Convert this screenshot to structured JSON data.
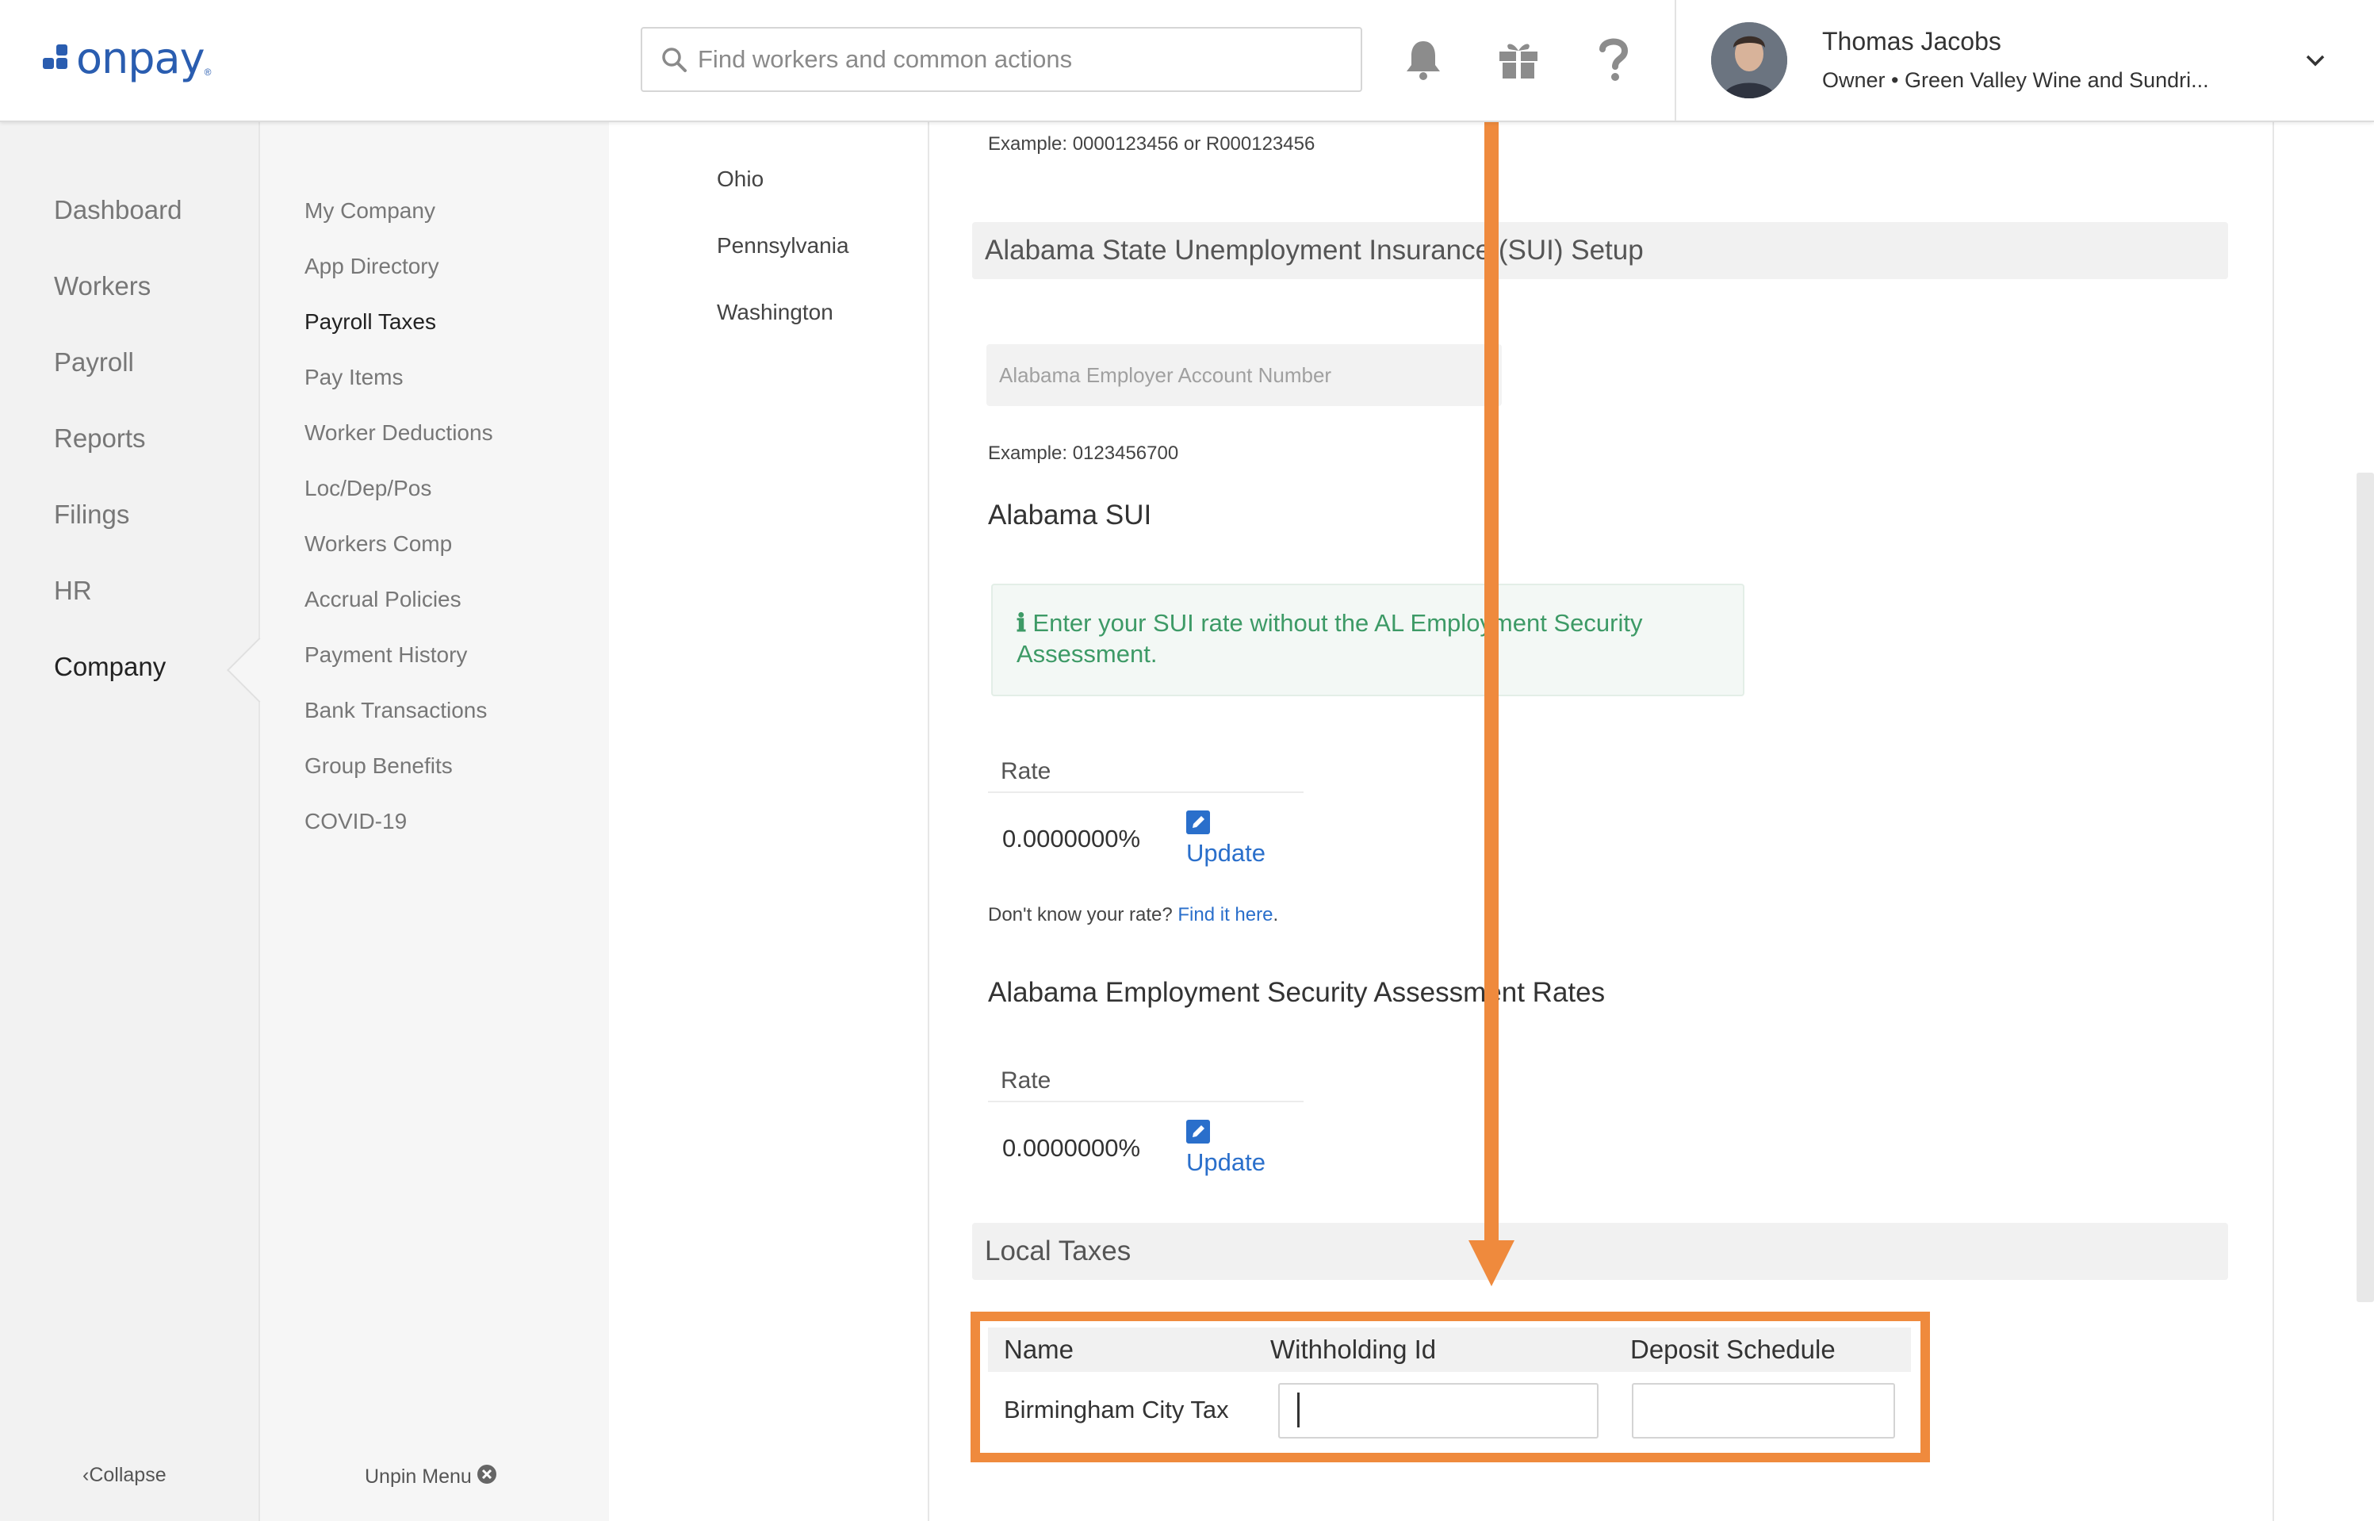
{
  "header": {
    "logo_text": "onpay",
    "logo_mark": "®",
    "search_placeholder": "Find workers and common actions",
    "icons": [
      "bell-icon",
      "gift-icon",
      "help-icon"
    ],
    "user": {
      "name": "Thomas Jacobs",
      "role": "Owner • Green Valley Wine and Sundri..."
    }
  },
  "nav": {
    "items": [
      "Dashboard",
      "Workers",
      "Payroll",
      "Reports",
      "Filings",
      "HR",
      "Company"
    ],
    "active": "Company",
    "collapse_label": "Collapse"
  },
  "subnav": {
    "items": [
      "My Company",
      "App Directory",
      "Payroll Taxes",
      "Pay Items",
      "Worker Deductions",
      "Loc/Dep/Pos",
      "Workers Comp",
      "Accrual Policies",
      "Payment History",
      "Bank Transactions",
      "Group Benefits",
      "COVID-19"
    ],
    "active": "Payroll Taxes",
    "unpin_label": "Unpin Menu"
  },
  "states": [
    "Ohio",
    "Pennsylvania",
    "Washington"
  ],
  "main": {
    "top_example": "Example: 0000123456 or R000123456",
    "sui_section_title": "Alabama State Unemployment Insurance (SUI) Setup",
    "account_placeholder": "Alabama Employer Account Number",
    "account_example": "Example: 0123456700",
    "sui_heading": "Alabama SUI",
    "alert_icon": "info-icon",
    "alert_text": "Enter your SUI rate without the AL Employment Security Assessment.",
    "rate_label": "Rate",
    "sui_rate": "0.0000000%",
    "update_label": "Update",
    "dont_know": "Don't know your rate?",
    "find_link": "Find it here",
    "esa_heading": "Alabama Employment Security Assessment Rates",
    "esa_rate": "0.0000000%",
    "local_taxes_title": "Local Taxes",
    "local_taxes": {
      "columns": [
        "Name",
        "Withholding Id",
        "Deposit Schedule"
      ],
      "rows": [
        {
          "name": "Birmingham City Tax",
          "withholding_id": "",
          "deposit_schedule": ""
        }
      ]
    }
  },
  "colors": {
    "brand": "#2a5db0",
    "annotation": "#ef8a3d",
    "link": "#2a6fcb",
    "alert_text": "#3d9a66"
  }
}
